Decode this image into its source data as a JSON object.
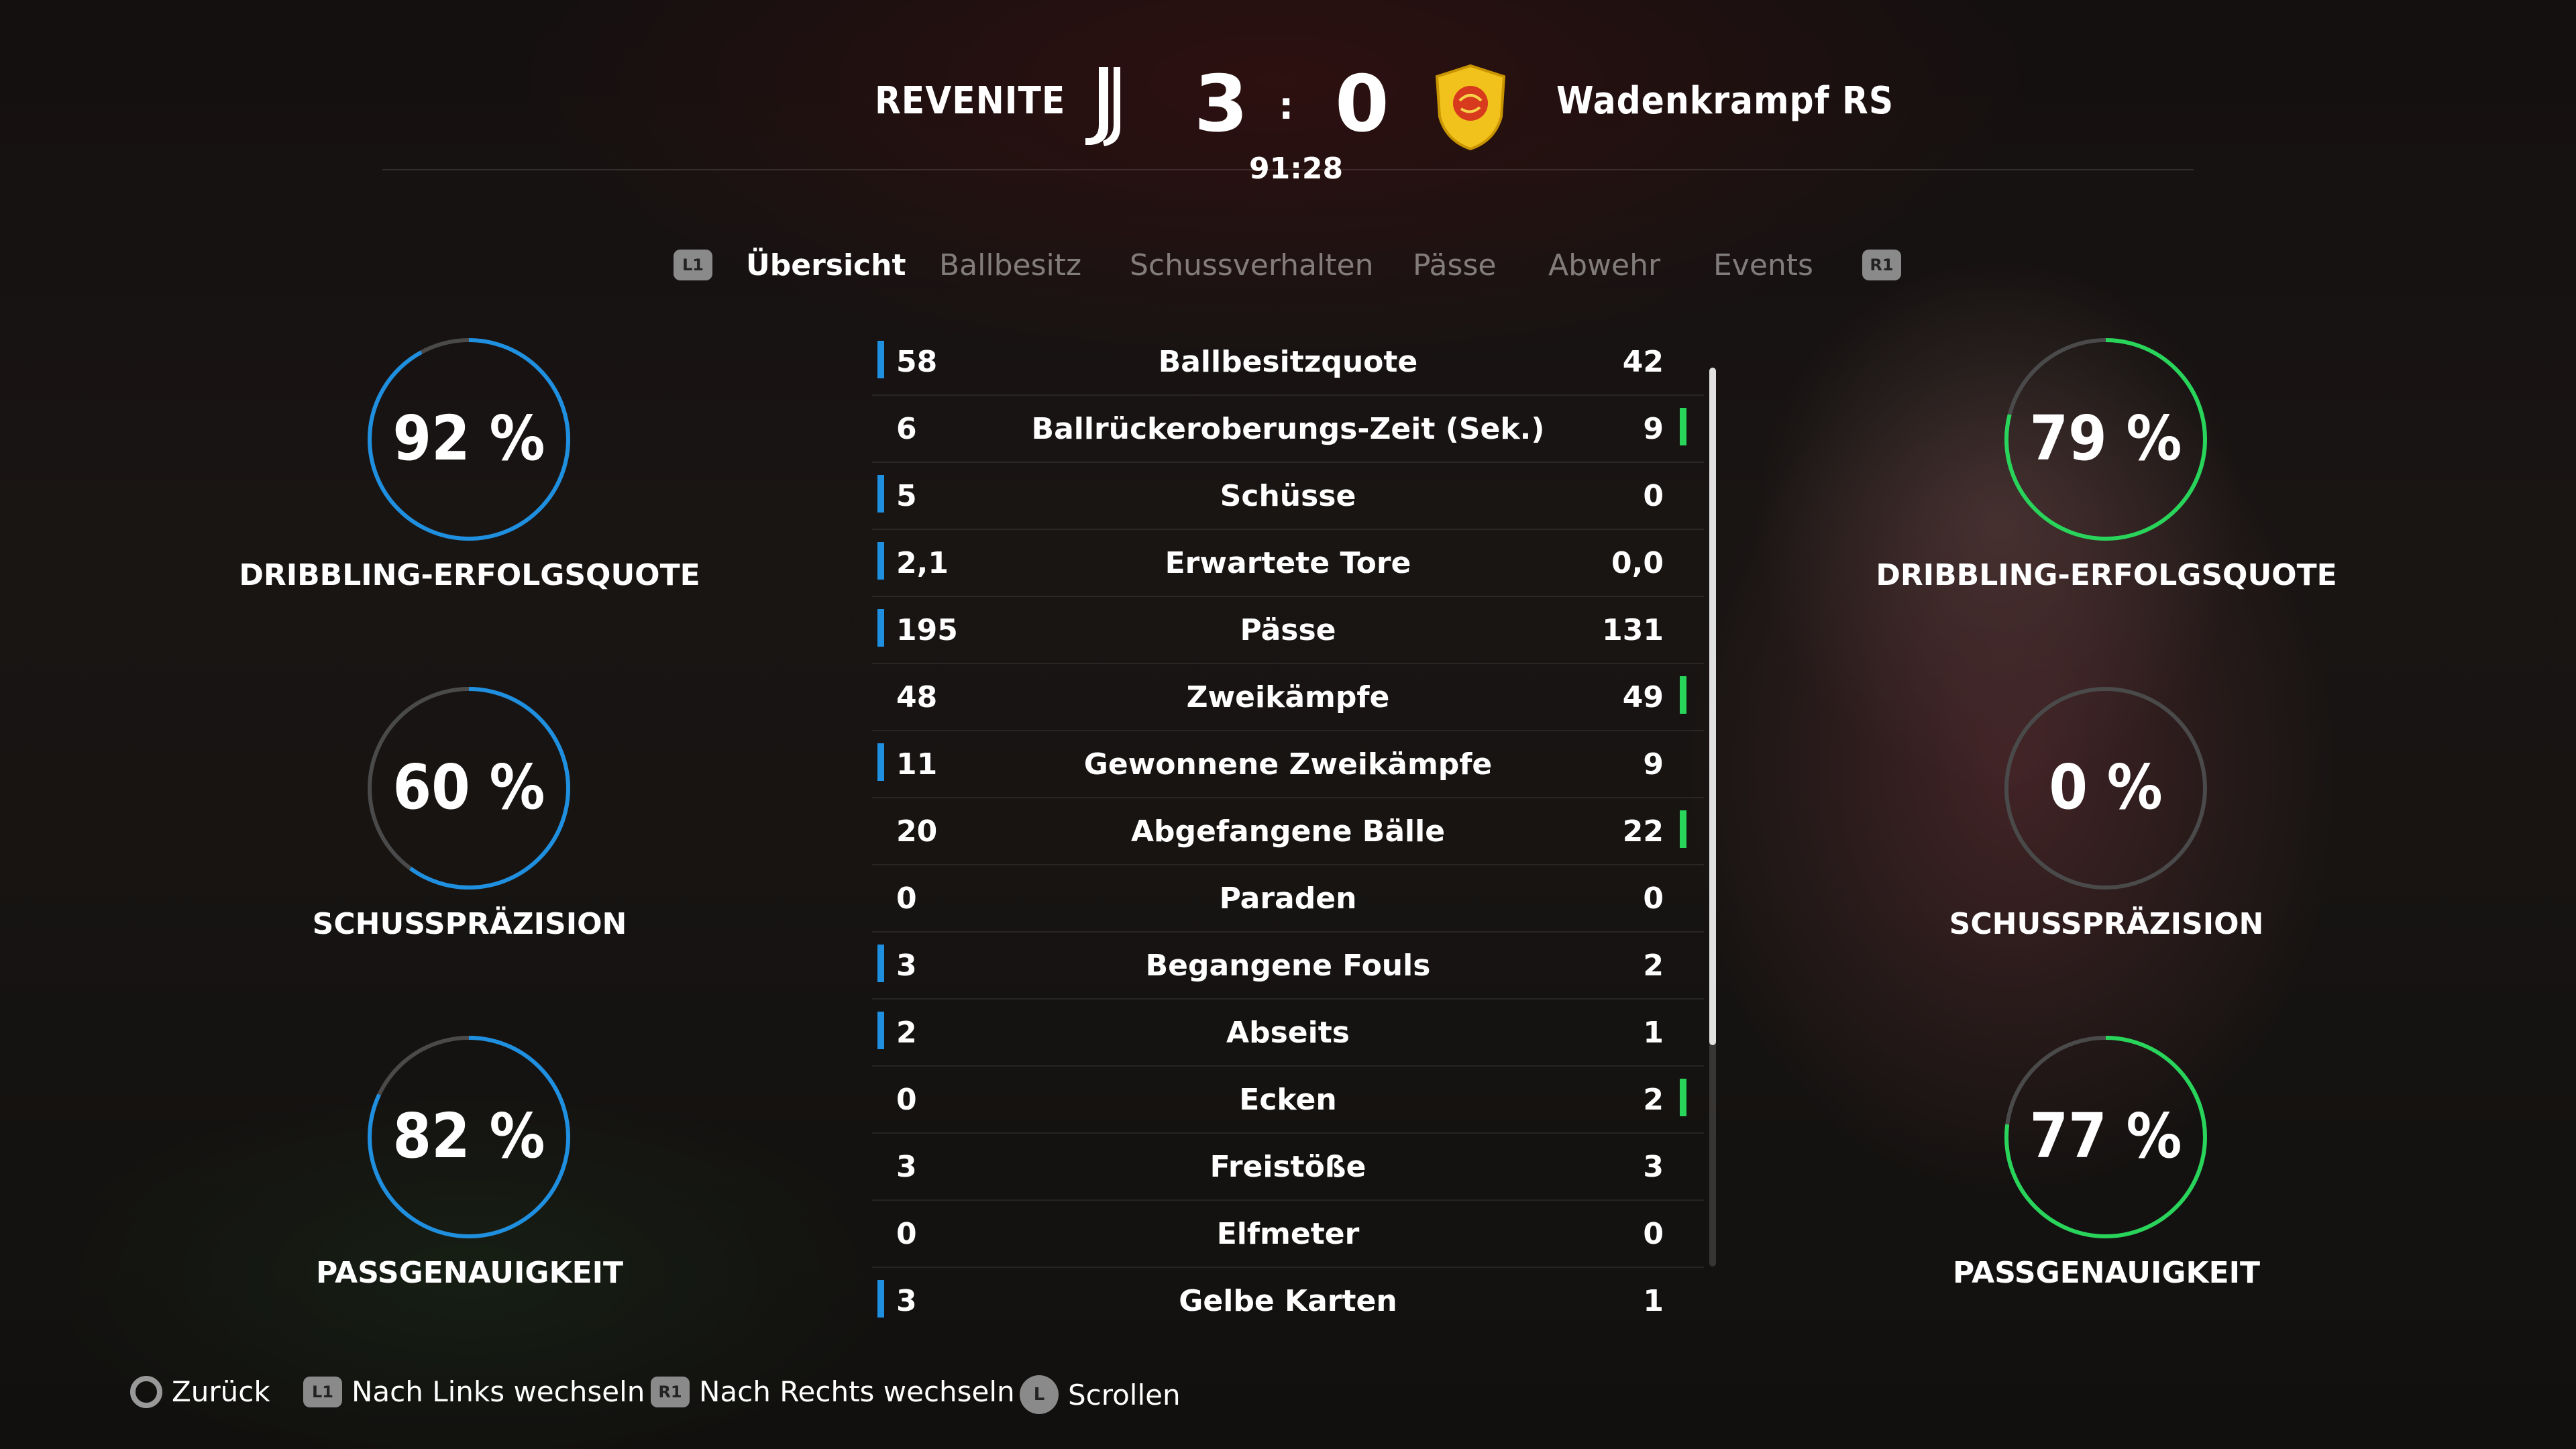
{
  "header": {
    "home_team": "REVENITE",
    "away_team": "Wadenkrampf RS",
    "home_score": "3",
    "separator": ":",
    "away_score": "0",
    "clock": "91:28"
  },
  "tabs": {
    "left_key": "L1",
    "right_key": "R1",
    "items": [
      "Übersicht",
      "Ballbesitz",
      "Schussverhalten",
      "Pässe",
      "Abwehr",
      "Events"
    ],
    "active": "Übersicht"
  },
  "home_rings": [
    {
      "value": "92 %",
      "fraction": 0.92,
      "label": "DRIBBLING-ERFOLGSQUOTE"
    },
    {
      "value": "60 %",
      "fraction": 0.6,
      "label": "SCHUSSPRÄZISION"
    },
    {
      "value": "82 %",
      "fraction": 0.82,
      "label": "PASSGENAUIGKEIT"
    }
  ],
  "away_rings": [
    {
      "value": "79 %",
      "fraction": 0.79,
      "label": "DRIBBLING-ERFOLGSQUOTE"
    },
    {
      "value": "0 %",
      "fraction": 0.0,
      "label": "SCHUSSPRÄZISION"
    },
    {
      "value": "77 %",
      "fraction": 0.77,
      "label": "PASSGENAUIGKEIT"
    }
  ],
  "colors": {
    "home_accent": "#1f8fe0",
    "away_accent": "#28d45a",
    "ring_track": "#4a4a4a"
  },
  "stats": [
    {
      "label": "Ballbesitzquote",
      "home": "58",
      "away": "42",
      "lead": "home"
    },
    {
      "label": "Ballrückeroberungs-Zeit (Sek.)",
      "home": "6",
      "away": "9",
      "lead": "away"
    },
    {
      "label": "Schüsse",
      "home": "5",
      "away": "0",
      "lead": "home"
    },
    {
      "label": "Erwartete Tore",
      "home": "2,1",
      "away": "0,0",
      "lead": "home"
    },
    {
      "label": "Pässe",
      "home": "195",
      "away": "131",
      "lead": "home"
    },
    {
      "label": "Zweikämpfe",
      "home": "48",
      "away": "49",
      "lead": "away"
    },
    {
      "label": "Gewonnene Zweikämpfe",
      "home": "11",
      "away": "9",
      "lead": "home"
    },
    {
      "label": "Abgefangene Bälle",
      "home": "20",
      "away": "22",
      "lead": "away"
    },
    {
      "label": "Paraden",
      "home": "0",
      "away": "0",
      "lead": "none"
    },
    {
      "label": "Begangene Fouls",
      "home": "3",
      "away": "2",
      "lead": "home"
    },
    {
      "label": "Abseits",
      "home": "2",
      "away": "1",
      "lead": "home"
    },
    {
      "label": "Ecken",
      "home": "0",
      "away": "2",
      "lead": "away"
    },
    {
      "label": "Freistöße",
      "home": "3",
      "away": "3",
      "lead": "none"
    },
    {
      "label": "Elfmeter",
      "home": "0",
      "away": "0",
      "lead": "none"
    },
    {
      "label": "Gelbe Karten",
      "home": "3",
      "away": "1",
      "lead": "home"
    }
  ],
  "footer": {
    "back": "Zurück",
    "left": "Nach Links wechseln",
    "left_key": "L1",
    "right": "Nach Rechts wechseln",
    "right_key": "R1",
    "scroll": "Scrollen",
    "scroll_key": "L"
  },
  "icons": {
    "home_crest": "juventus-style-j-icon",
    "away_crest": "yellow-shield-crest-icon",
    "back_button": "circle-button-icon"
  }
}
